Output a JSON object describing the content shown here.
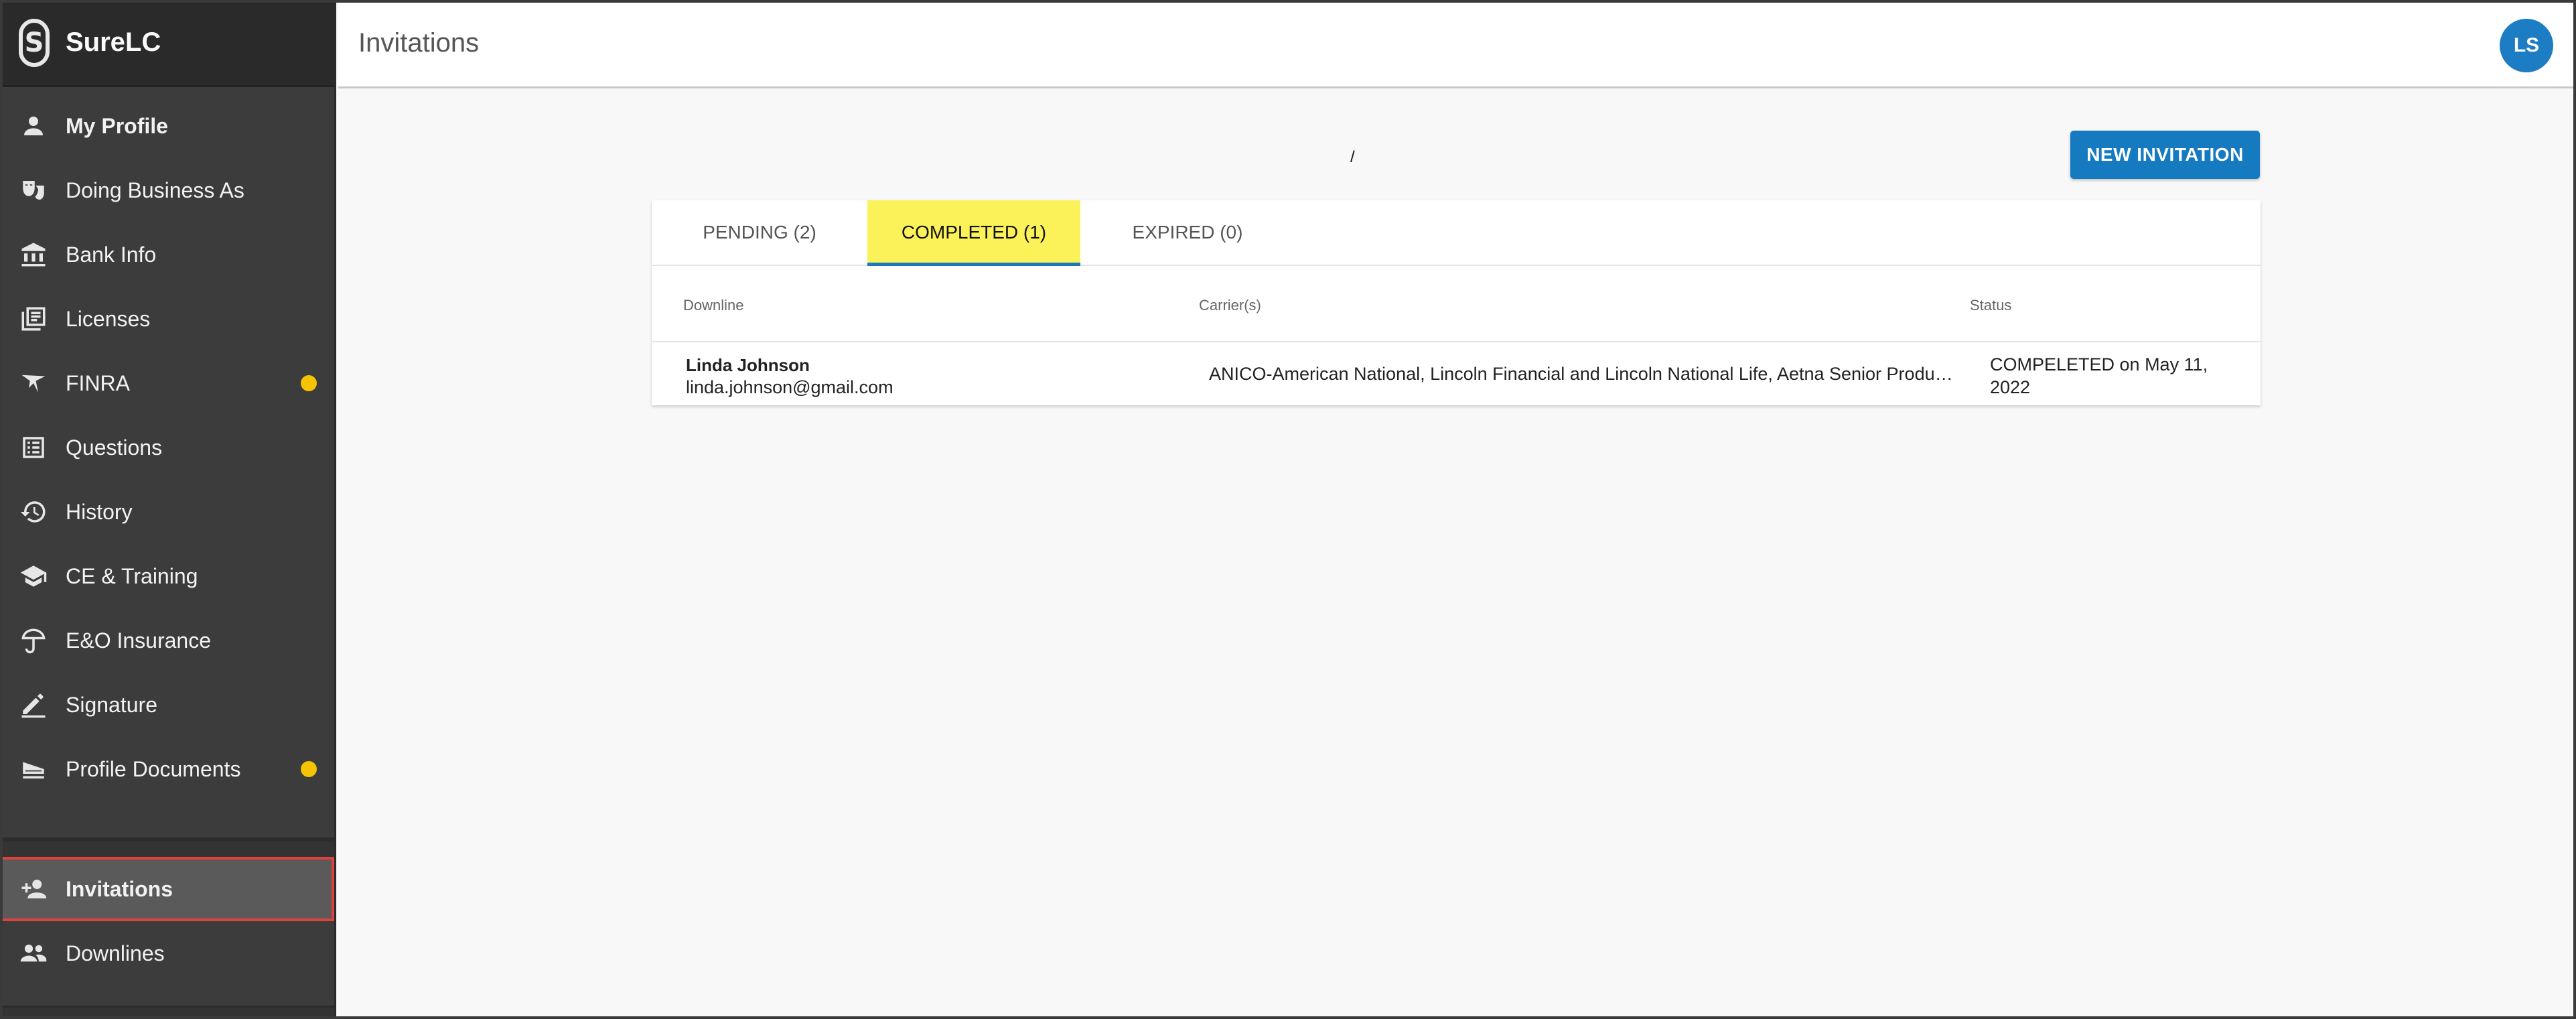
{
  "brand": {
    "logo_glyph": "S",
    "name": "SureLC"
  },
  "sidebar": {
    "items": [
      {
        "label": "My Profile",
        "icon": "person-icon",
        "badge": false
      },
      {
        "label": "Doing Business As",
        "icon": "mask-icon",
        "badge": false
      },
      {
        "label": "Bank Info",
        "icon": "bank-icon",
        "badge": false
      },
      {
        "label": "Licenses",
        "icon": "licenses-icon",
        "badge": false
      },
      {
        "label": "FINRA",
        "icon": "finra-icon",
        "badge": true
      },
      {
        "label": "Questions",
        "icon": "list-icon",
        "badge": false
      },
      {
        "label": "History",
        "icon": "history-icon",
        "badge": false
      },
      {
        "label": "CE & Training",
        "icon": "graduation-cap-icon",
        "badge": false
      },
      {
        "label": "E&O Insurance",
        "icon": "umbrella-icon",
        "badge": false
      },
      {
        "label": "Signature",
        "icon": "pen-icon",
        "badge": false
      },
      {
        "label": "Profile Documents",
        "icon": "scanner-icon",
        "badge": true
      }
    ],
    "secondary": [
      {
        "label": "Invitations",
        "icon": "person-add-icon",
        "active": true
      },
      {
        "label": "Downlines",
        "icon": "people-icon",
        "active": false
      }
    ]
  },
  "header": {
    "title": "Invitations",
    "avatar_initials": "LS"
  },
  "main": {
    "new_invitation_label": "NEW INVITATION",
    "stray_mark": "/",
    "tabs": [
      {
        "label": "PENDING (2)",
        "active": false
      },
      {
        "label": "COMPLETED (1)",
        "active": true
      },
      {
        "label": "EXPIRED (0)",
        "active": false
      }
    ],
    "columns": {
      "downline": "Downline",
      "carriers": "Carrier(s)",
      "status": "Status"
    },
    "rows": [
      {
        "name": "Linda Johnson",
        "email": "linda.johnson@gmail.com",
        "carriers": "ANICO-American National, Lincoln Financial and Lincoln National Life, Aetna Senior Products",
        "status": "COMPELETED on May 11, 2022"
      }
    ]
  },
  "colors": {
    "sidebar_bg": "#3c3c3c",
    "brand_bg": "#2a2a2a",
    "accent_blue": "#157ac0",
    "active_tab_bg": "#fbf25a",
    "badge_yellow": "#f5c400",
    "highlight_red": "#e0413b"
  }
}
